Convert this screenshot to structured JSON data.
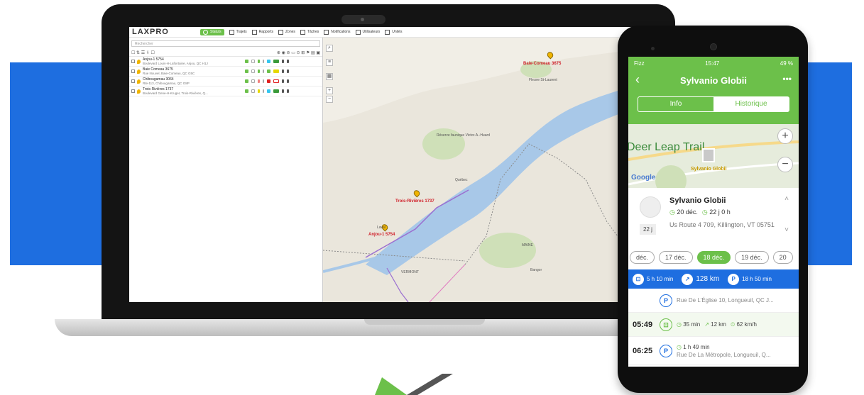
{
  "laptop_app": {
    "logo": "LAXPRO",
    "nav": [
      {
        "label": "Statuts",
        "icon": "status-icon",
        "active": true
      },
      {
        "label": "Trajets",
        "icon": "flag-icon"
      },
      {
        "label": "Rapports",
        "icon": "report-icon"
      },
      {
        "label": "Zones",
        "icon": "zone-icon"
      },
      {
        "label": "Tâches",
        "icon": "tasks-icon"
      },
      {
        "label": "Notifications",
        "icon": "bell-icon"
      },
      {
        "label": "Utilisateurs",
        "icon": "users-icon"
      },
      {
        "label": "Unités",
        "icon": "vehicle-icon"
      }
    ],
    "search_placeholder": "Rechercher",
    "units": [
      {
        "name": "Anjou-1 5754",
        "address": "Boulevard Louis-H-Lafontaine, Anjou, QC H1J"
      },
      {
        "name": "Baie Comeau 3675",
        "address": "Rue Nouvel, Baie-Comeau, QC G5C"
      },
      {
        "name": "Chibougamau 3064",
        "address": "Rte-113, Chibougamau, QC G8P"
      },
      {
        "name": "Trois-Rivières 1737",
        "address": "Boulevard Gene-H-Kruger, Trois-Rivières, Q..."
      }
    ],
    "map": {
      "markers": [
        {
          "label": "Baie-Comeau 3675"
        },
        {
          "label": "Trois-Rivières 1737"
        },
        {
          "label": "Anjou-1 5754"
        }
      ],
      "places": [
        "Fleuve St-Laurent",
        "Réserve faunique Victor-A.-Huard",
        "Québec",
        "MAINE",
        "VERMONT",
        "Bangor",
        "Laval"
      ]
    }
  },
  "phone": {
    "status_carrier": "Fizz",
    "status_time": "15:47",
    "status_battery": "49 %",
    "title": "Sylvanio Globii",
    "tabs": [
      {
        "label": "Info"
      },
      {
        "label": "Historique",
        "selected": true
      }
    ],
    "map_trail": "Deer Leap Trail",
    "map_google": "Google",
    "map_person": "Sylvanio Globii",
    "card_name": "Sylvanio Globii",
    "card_date": "20 déc.",
    "card_duration": "22 j 0 h",
    "card_days": "22 j",
    "card_address": "Us Route 4 709, Killington, VT 05751",
    "days": [
      "déc.",
      "17 déc.",
      "18 déc.",
      "19 déc.",
      "20"
    ],
    "selected_day": "18 déc.",
    "summary": {
      "driving": "5 h 10 min",
      "distance": "128 km",
      "parking": "18 h 50 min"
    },
    "entries": [
      {
        "time": "",
        "type": "P",
        "text": "Rue De L'Église 10, Longueuil, QC J..."
      },
      {
        "time": "05:49",
        "type": "drive",
        "duration": "35 min",
        "distance": "12 km",
        "speed": "62 km/h"
      },
      {
        "time": "06:25",
        "type": "P",
        "duration": "1 h 49 min",
        "text": "Rue De La Métropole, Longueuil, Q..."
      }
    ]
  },
  "colors": {
    "brand_green": "#6cc04a",
    "brand_blue": "#1e6ee0"
  }
}
